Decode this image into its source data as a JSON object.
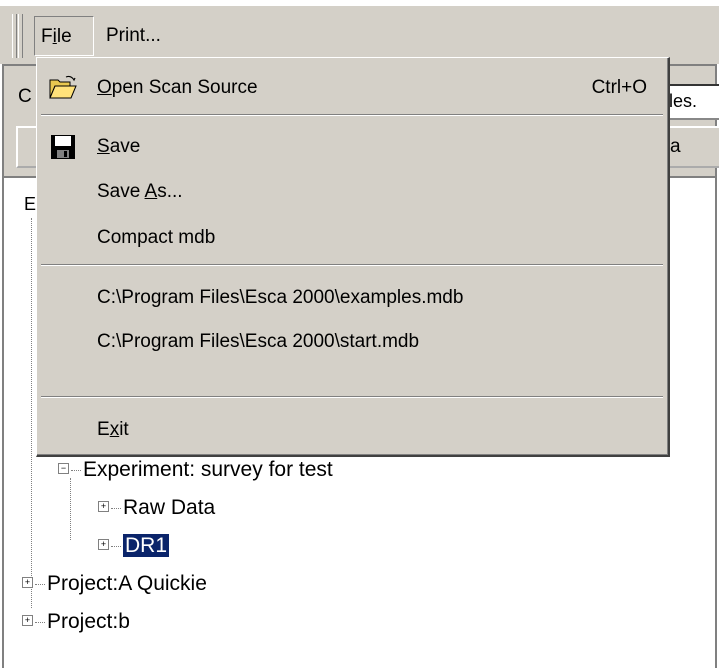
{
  "menubar": {
    "file_label": "File",
    "print_label": "Print..."
  },
  "background": {
    "combo_prefix": "C",
    "combo_tail": "les.",
    "button_tail": "a",
    "tree_root_glyph": "E"
  },
  "file_menu": {
    "open": {
      "label": "Open Scan Source",
      "shortcut": "Ctrl+O",
      "icon": "folder-open-icon"
    },
    "save": {
      "label": "Save",
      "icon": "floppy-disk-icon"
    },
    "save_as": {
      "label": "Save As..."
    },
    "compact": {
      "label": "Compact mdb"
    },
    "recent": [
      "C:\\Program Files\\Esca 2000\\examples.mdb",
      "C:\\Program Files\\Esca 2000\\start.mdb"
    ],
    "exit": {
      "label": "Exit"
    }
  },
  "tree": {
    "experiment": "Experiment: survey for test",
    "raw_data": "Raw Data",
    "dr1": "DR1",
    "project_a": "Project:A Quickie",
    "project_b": "Project:b",
    "expand_glyph": "+",
    "collapse_glyph": "−"
  }
}
